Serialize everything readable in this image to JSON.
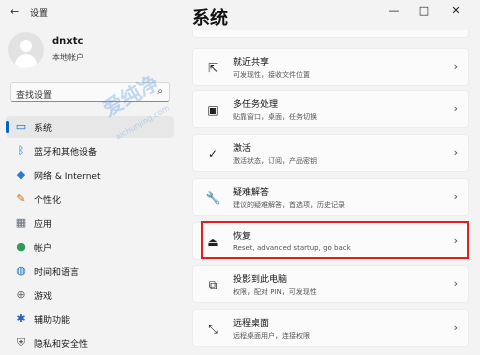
{
  "window": {
    "app_title": "设置",
    "back_icon": "←",
    "minimize_icon": "—",
    "maximize_icon": "□",
    "close_icon": "✕"
  },
  "user": {
    "name": "dnxtc",
    "account_type": "本地帐户"
  },
  "search": {
    "placeholder": "查找设置",
    "icon": "⌕"
  },
  "sidebar": {
    "items": [
      {
        "label": "系统",
        "icon": "monitor-icon",
        "glyph": "▭",
        "color": "#0067c0",
        "selected": true
      },
      {
        "label": "蓝牙和其他设备",
        "icon": "bluetooth-icon",
        "glyph": "ᛒ",
        "color": "#1f6fd0"
      },
      {
        "label": "网络 & Internet",
        "icon": "wifi-icon",
        "glyph": "◆",
        "color": "#2a7ad6"
      },
      {
        "label": "个性化",
        "icon": "pen-icon",
        "glyph": "✎",
        "color": "#c56b21"
      },
      {
        "label": "应用",
        "icon": "apps-icon",
        "glyph": "▦",
        "color": "#5f6b7a"
      },
      {
        "label": "帐户",
        "icon": "person-icon",
        "glyph": "●",
        "color": "#2f9a5a"
      },
      {
        "label": "时间和语言",
        "icon": "globe-icon",
        "glyph": "◍",
        "color": "#1c6fbf"
      },
      {
        "label": "游戏",
        "icon": "gamepad-icon",
        "glyph": "⊕",
        "color": "#6a6a6a"
      },
      {
        "label": "辅助功能",
        "icon": "accessibility-icon",
        "glyph": "✱",
        "color": "#2060c0"
      },
      {
        "label": "隐私和安全性",
        "icon": "shield-icon",
        "glyph": "⛨",
        "color": "#555555"
      }
    ]
  },
  "main": {
    "title": "系统",
    "cards": [
      {
        "title": "就近共享",
        "subtitle": "可发现性，接收文件位置",
        "icon": "share-icon",
        "glyph": "⇱"
      },
      {
        "title": "多任务处理",
        "subtitle": "贴靠窗口，桌面，任务切换",
        "icon": "multitask-icon",
        "glyph": "▣"
      },
      {
        "title": "激活",
        "subtitle": "激活状态，订阅，产品密钥",
        "icon": "check-circle-icon",
        "glyph": "✓"
      },
      {
        "title": "疑难解答",
        "subtitle": "建议的疑难解答，首选项，历史记录",
        "icon": "wrench-icon",
        "glyph": "🔧"
      },
      {
        "title": "恢复",
        "subtitle": "Reset, advanced startup, go back",
        "icon": "recovery-icon",
        "glyph": "⏏"
      },
      {
        "title": "投影到此电脑",
        "subtitle": "权限，配对 PIN，可发现性",
        "icon": "projection-icon",
        "glyph": "⧉"
      },
      {
        "title": "远程桌面",
        "subtitle": "远程桌面用户，连接权限",
        "icon": "remote-desktop-icon",
        "glyph": "⤡"
      }
    ]
  },
  "watermark": {
    "text": "爱纯净",
    "sub": "aichunjing.com"
  },
  "accent_color": "#0067c0",
  "highlight_color": "#e0201c"
}
